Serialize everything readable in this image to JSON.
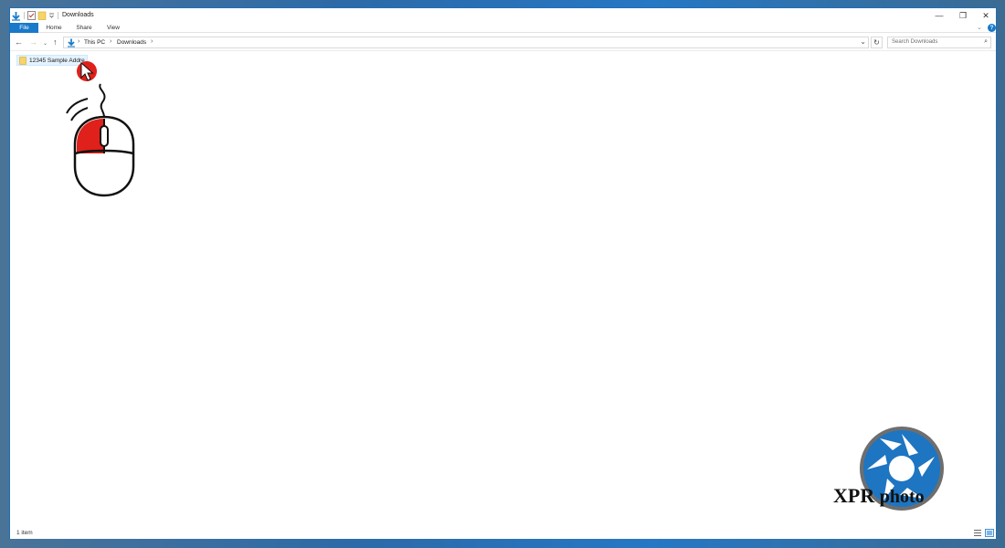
{
  "window": {
    "title": "Downloads"
  },
  "title_controls": {
    "minimize": "—",
    "maximize": "❐",
    "close": "✕"
  },
  "ribbon": {
    "tabs": [
      {
        "label": "File"
      },
      {
        "label": "Home"
      },
      {
        "label": "Share"
      },
      {
        "label": "View"
      }
    ],
    "expand_glyph": "⌄",
    "help_glyph": "?"
  },
  "navigation": {
    "back_glyph": "←",
    "forward_glyph": "→",
    "recent_glyph": "⌄",
    "up_glyph": "↑",
    "breadcrumb": [
      "This PC",
      "Downloads"
    ],
    "separator_glyph": "›",
    "address_dropdown_glyph": "⌄",
    "refresh_glyph": "↻",
    "search_placeholder": "Search Downloads",
    "search_glyph": "⌕"
  },
  "content": {
    "items": [
      {
        "name": "12345 Sample Addre",
        "type": "folder"
      }
    ]
  },
  "status": {
    "item_count": "1 item"
  },
  "watermark": {
    "brand_upper": "XPR",
    "brand_lower": "photo"
  },
  "colors": {
    "accent": "#1979ca",
    "cursor_red": "#e0201a",
    "folder_yellow": "#f6d46a",
    "logo_blue": "#1e75c2"
  }
}
